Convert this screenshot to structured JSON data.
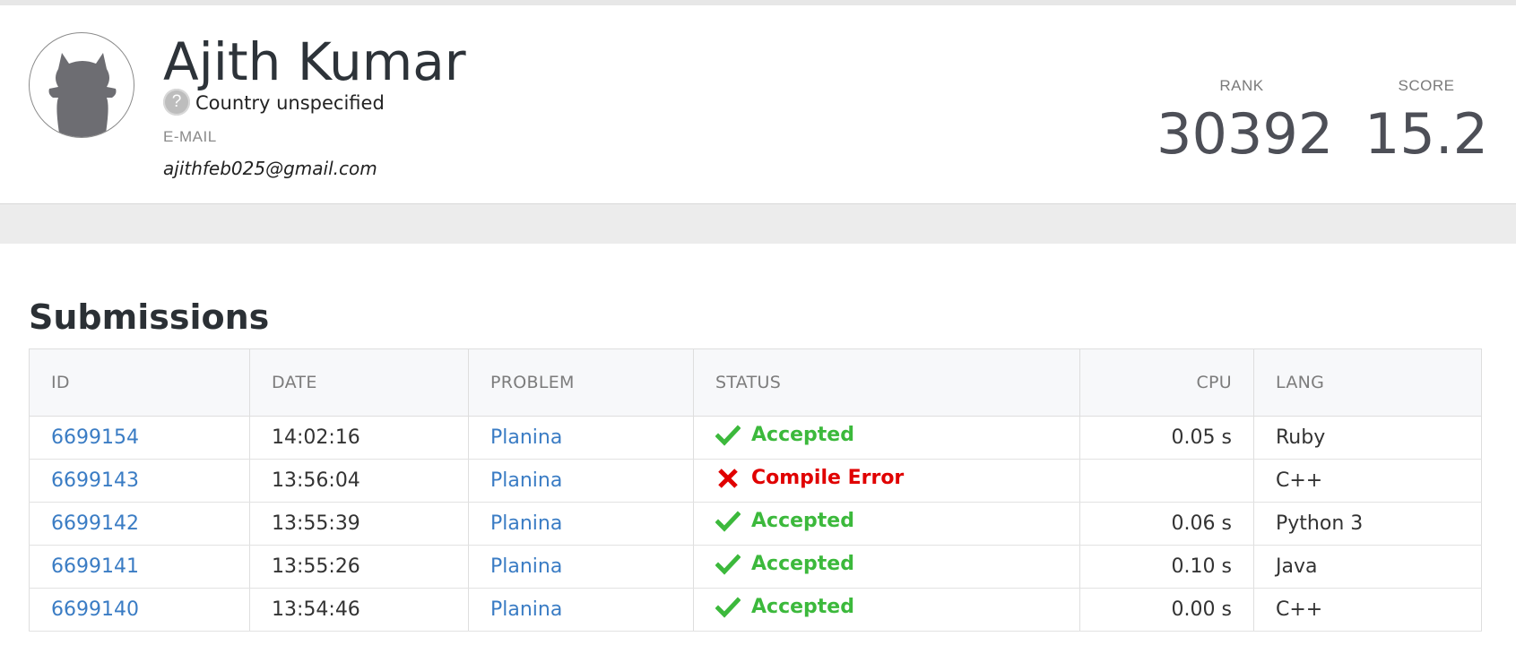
{
  "profile": {
    "name": "Ajith Kumar",
    "country": "Country unspecified",
    "email_label": "E-MAIL",
    "email": "ajithfeb025@gmail.com",
    "rank_label": "RANK",
    "rank_value": "30392",
    "score_label": "SCORE",
    "score_value": "15.2"
  },
  "submissions": {
    "title": "Submissions",
    "columns": [
      "ID",
      "DATE",
      "PROBLEM",
      "STATUS",
      "CPU",
      "LANG"
    ],
    "rows": [
      {
        "id": "6699154",
        "date": "14:02:16",
        "problem": "Planina",
        "status": "Accepted",
        "status_type": "accepted",
        "cpu": "0.05 s",
        "lang": "Ruby"
      },
      {
        "id": "6699143",
        "date": "13:56:04",
        "problem": "Planina",
        "status": "Compile Error",
        "status_type": "error",
        "cpu": "",
        "lang": "C++"
      },
      {
        "id": "6699142",
        "date": "13:55:39",
        "problem": "Planina",
        "status": "Accepted",
        "status_type": "accepted",
        "cpu": "0.06 s",
        "lang": "Python 3"
      },
      {
        "id": "6699141",
        "date": "13:55:26",
        "problem": "Planina",
        "status": "Accepted",
        "status_type": "accepted",
        "cpu": "0.10 s",
        "lang": "Java"
      },
      {
        "id": "6699140",
        "date": "13:54:46",
        "problem": "Planina",
        "status": "Accepted",
        "status_type": "accepted",
        "cpu": "0.00 s",
        "lang": "C++"
      }
    ]
  },
  "colors": {
    "accepted": "#3cb93c",
    "error": "#e00000",
    "link": "#3a7cc4"
  },
  "icons": {
    "accepted": "checkmark-icon",
    "error": "cross-icon",
    "country": "question-mark-icon",
    "avatar": "cat-silhouette-icon"
  }
}
